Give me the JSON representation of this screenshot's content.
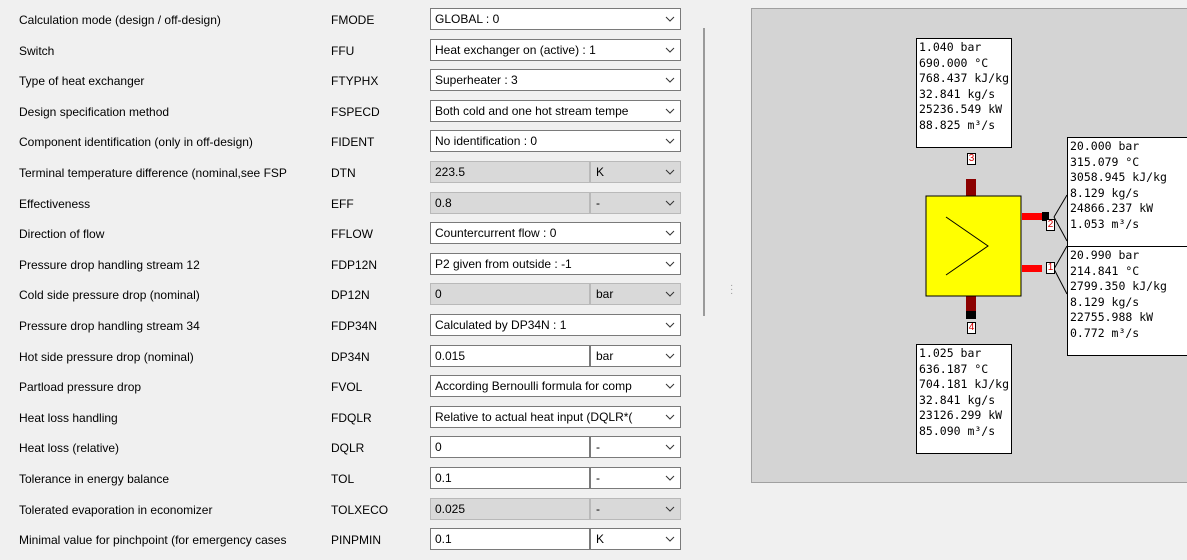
{
  "properties": [
    {
      "label": "Calculation mode (design / off-design)",
      "code": "FMODE",
      "kind": "select",
      "value": "GLOBAL : 0"
    },
    {
      "label": "Switch",
      "code": "FFU",
      "kind": "select",
      "value": "Heat exchanger on (active) : 1"
    },
    {
      "label": "Type of heat exchanger",
      "code": "FTYPHX",
      "kind": "select",
      "value": "Superheater : 3"
    },
    {
      "label": "Design specification method",
      "code": "FSPECD",
      "kind": "select",
      "value": "Both cold and one hot stream tempe"
    },
    {
      "label": "Component identification (only in off-design)",
      "code": "FIDENT",
      "kind": "select",
      "value": "No identification : 0"
    },
    {
      "label": "Terminal temperature difference (nominal,see FSP",
      "code": "DTN",
      "kind": "value",
      "value": "223.5",
      "unit": "K",
      "gray": true
    },
    {
      "label": "Effectiveness",
      "code": "EFF",
      "kind": "value",
      "value": "0.8",
      "unit": "-",
      "gray": true
    },
    {
      "label": "Direction of flow",
      "code": "FFLOW",
      "kind": "select",
      "value": "Countercurrent flow : 0"
    },
    {
      "label": "Pressure drop handling stream 12",
      "code": "FDP12N",
      "kind": "select",
      "value": "P2 given from outside : -1"
    },
    {
      "label": "Cold side pressure drop (nominal)",
      "code": "DP12N",
      "kind": "value",
      "value": "0",
      "unit": "bar",
      "gray": true
    },
    {
      "label": "Pressure drop handling stream 34",
      "code": "FDP34N",
      "kind": "select",
      "value": "Calculated by DP34N : 1"
    },
    {
      "label": "Hot side pressure drop (nominal)",
      "code": "DP34N",
      "kind": "value",
      "value": "0.015",
      "unit": "bar",
      "gray": false
    },
    {
      "label": "Partload pressure drop",
      "code": "FVOL",
      "kind": "select",
      "value": "According Bernoulli formula for comp"
    },
    {
      "label": "Heat loss handling",
      "code": "FDQLR",
      "kind": "select",
      "value": "Relative to actual heat input (DQLR*("
    },
    {
      "label": "Heat loss (relative)",
      "code": "DQLR",
      "kind": "value",
      "value": "0",
      "unit": "-",
      "gray": false
    },
    {
      "label": "Tolerance in energy balance",
      "code": "TOL",
      "kind": "value",
      "value": "0.1",
      "unit": "-",
      "gray": false
    },
    {
      "label": "Tolerated evaporation in economizer",
      "code": "TOLXECO",
      "kind": "value",
      "value": "0.025",
      "unit": "-",
      "gray": true
    },
    {
      "label": "Minimal value for pinchpoint (for emergency cases",
      "code": "PINPMIN",
      "kind": "value",
      "value": "0.1",
      "unit": "K",
      "gray": false
    }
  ],
  "diagram": {
    "ports": [
      {
        "id": "port1",
        "label": "1",
        "lines": [
          "20.990 bar",
          "214.841 °C",
          "2799.350 kJ/kg",
          "8.129 kg/s",
          "22755.988 kW",
          "0.772 m³/s"
        ]
      },
      {
        "id": "port2",
        "label": "2",
        "lines": [
          "20.000 bar",
          "315.079 °C",
          "3058.945 kJ/kg",
          "8.129 kg/s",
          "24866.237 kW",
          "1.053 m³/s"
        ]
      },
      {
        "id": "port3",
        "label": "3",
        "lines": [
          "1.040 bar",
          "690.000 °C",
          "768.437 kJ/kg",
          "32.841 kg/s",
          "25236.549 kW",
          "88.825 m³/s"
        ]
      },
      {
        "id": "port4",
        "label": "4",
        "lines": [
          "1.025 bar",
          "636.187 °C",
          "704.181 kJ/kg",
          "32.841 kg/s",
          "23126.299 kW",
          "85.090 m³/s"
        ]
      }
    ],
    "colors": {
      "component": "#ffff00",
      "cold_pipe": "#ff0000",
      "hot_pipe": "#8b0000",
      "label_text": "#d00000"
    }
  }
}
